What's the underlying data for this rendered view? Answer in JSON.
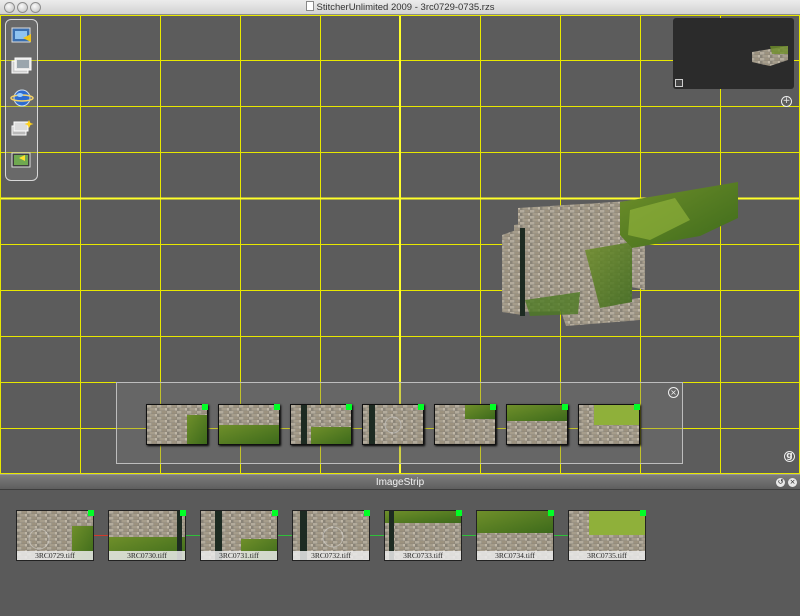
{
  "window": {
    "title": "StitcherUnlimited 2009 - 3rc0729-0735.rzs"
  },
  "colors": {
    "canvas": "#5c5c5c",
    "grid": "#e8e800",
    "match_dot": "#00ff26",
    "link_red": "#d23a2a",
    "link_green": "#2fbf3a"
  },
  "toolbar": {
    "tools": [
      {
        "name": "import-images-icon"
      },
      {
        "name": "image-list-icon"
      },
      {
        "name": "sphere-render-icon"
      },
      {
        "name": "stitch-magic-icon"
      },
      {
        "name": "export-render-icon"
      }
    ]
  },
  "navigator": {
    "zoom_icon": "zoom-in-icon",
    "resize_icon": "resize-corner-icon"
  },
  "overlay_strip": {
    "close_symbol": "×",
    "grid_toggle_symbol": "g",
    "thumbnails": [
      "3RC0729",
      "3RC0730",
      "3RC0731",
      "3RC0732",
      "3RC0733",
      "3RC0734",
      "3RC0735"
    ]
  },
  "image_strip": {
    "title": "ImageStrip",
    "buttons": {
      "detach": "↺",
      "close": "×"
    },
    "items": [
      {
        "label": "3RC0729.tiff",
        "link": "red"
      },
      {
        "label": "3RC0730.tiff",
        "link": "green"
      },
      {
        "label": "3RC0731.tiff",
        "link": "green"
      },
      {
        "label": "3RC0732.tiff",
        "link": "green"
      },
      {
        "label": "3RC0733.tiff",
        "link": "green"
      },
      {
        "label": "3RC0734.tiff",
        "link": "green"
      },
      {
        "label": "3RC0735.tiff",
        "link": "none"
      }
    ]
  }
}
